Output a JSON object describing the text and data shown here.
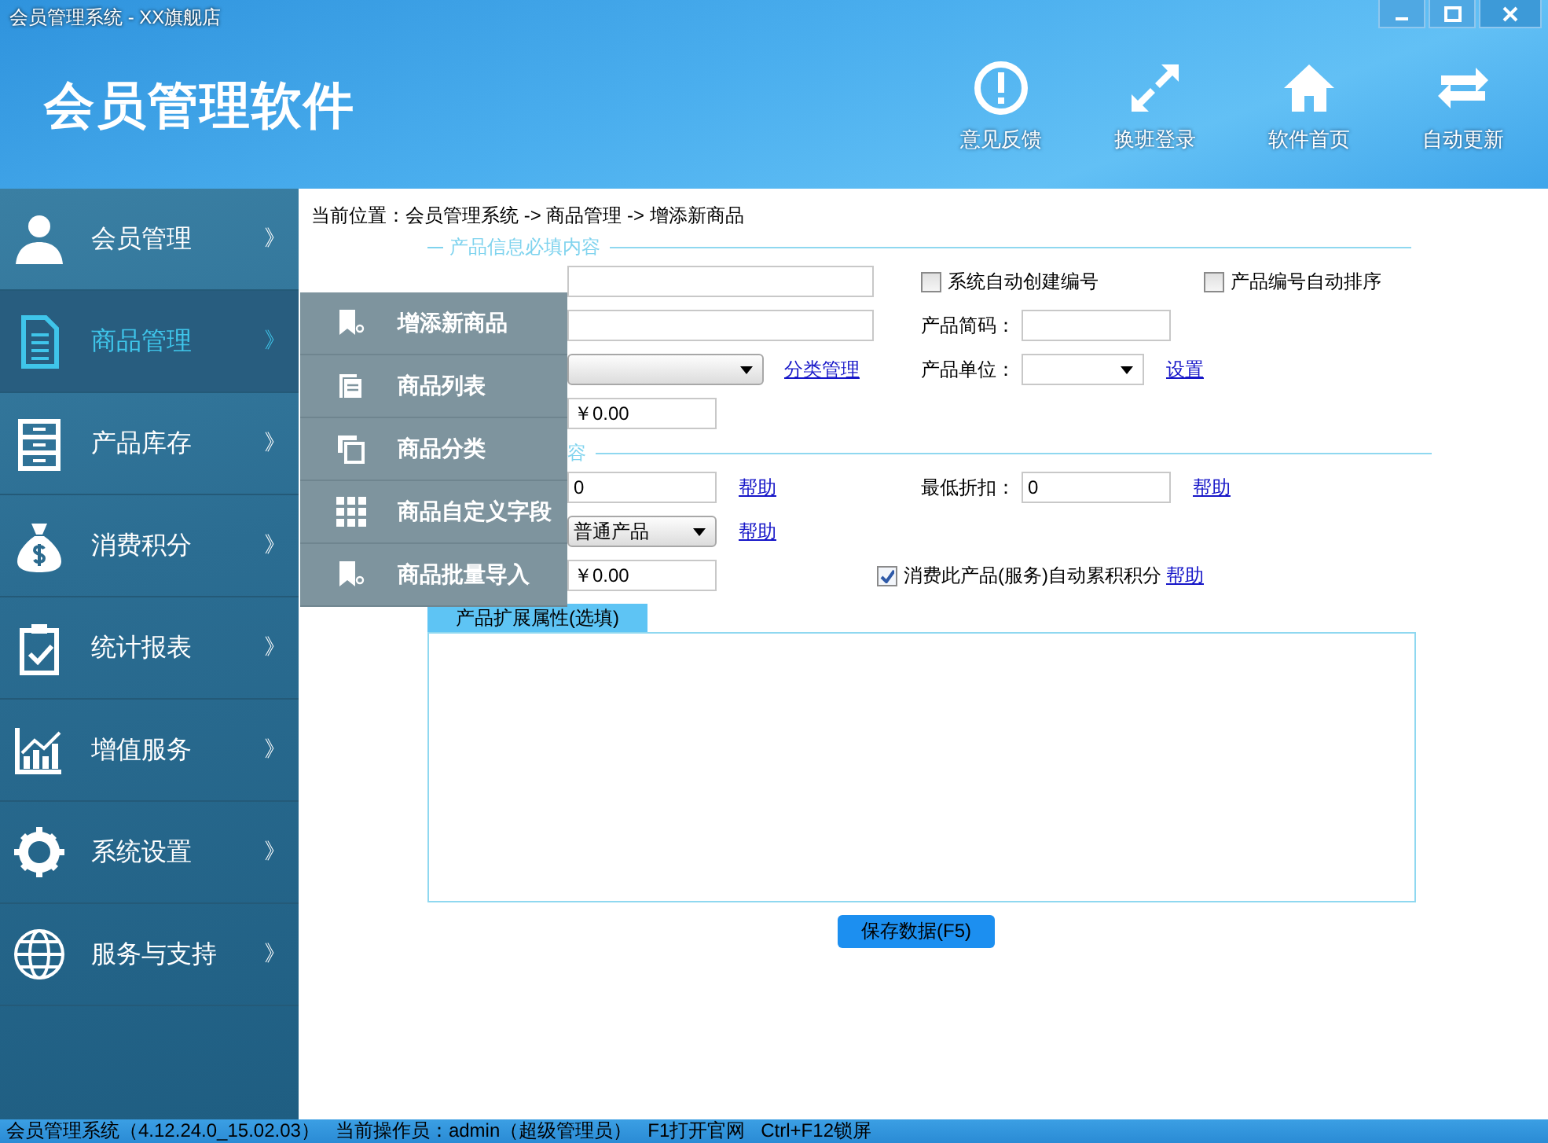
{
  "window": {
    "title": "会员管理系统 - XX旗舰店",
    "controls": [
      {
        "kind": "minimize"
      },
      {
        "kind": "maximize"
      },
      {
        "kind": "close"
      }
    ]
  },
  "app_title": "会员管理软件",
  "toolbar": [
    {
      "label": "意见反馈"
    },
    {
      "label": "换班登录"
    },
    {
      "label": "软件首页"
    },
    {
      "label": "自动更新"
    }
  ],
  "sidebar": {
    "items": [
      {
        "label": "会员管理",
        "arrow": "》",
        "selected": false
      },
      {
        "label": "商品管理",
        "arrow": "》",
        "selected": true
      },
      {
        "label": "产品库存",
        "arrow": "》",
        "selected": false
      },
      {
        "label": "消费积分",
        "arrow": "》",
        "selected": false
      },
      {
        "label": "统计报表",
        "arrow": "》",
        "selected": false
      },
      {
        "label": "增值服务",
        "arrow": "》",
        "selected": false
      },
      {
        "label": "系统设置",
        "arrow": "》",
        "selected": false
      },
      {
        "label": "服务与支持",
        "arrow": "》",
        "selected": false
      }
    ]
  },
  "submenu": [
    {
      "label": "增添新商品"
    },
    {
      "label": "商品列表"
    },
    {
      "label": "商品分类"
    },
    {
      "label": "商品自定义字段"
    },
    {
      "label": "商品批量导入"
    }
  ],
  "breadcrumb": "当前位置：会员管理系统 -> 商品管理 -> 增添新商品",
  "sections": [
    {
      "legend": "产品信息必填内容",
      "rows": [
        [
          [
            {
              "kind": "input"
            }
          ],
          [
            {
              "kind": "checkbox",
              "label": "系统自动创建编号",
              "checked": false
            }
          ],
          [
            {
              "kind": "checkbox",
              "label": "产品编号自动排序",
              "checked": false
            }
          ]
        ],
        [
          [
            {
              "kind": "input"
            }
          ],
          [
            {
              "kind": "label",
              "text": "产品简码："
            },
            {
              "kind": "short-input"
            }
          ],
          []
        ],
        [
          [
            {
              "kind": "select"
            },
            {
              "kind": "link",
              "text": "分类管理"
            }
          ],
          [
            {
              "kind": "label",
              "text": "产品单位："
            },
            {
              "kind": "short-select"
            },
            {
              "kind": "link",
              "text": "设置"
            }
          ],
          []
        ],
        [
          [
            {
              "kind": "short-input",
              "value": "￥0.00"
            }
          ],
          [],
          []
        ]
      ]
    },
    {
      "legend": "容",
      "rows": [
        [
          [
            {
              "kind": "short-input",
              "value": "0"
            },
            {
              "kind": "link",
              "text": "帮助"
            }
          ],
          [
            {
              "kind": "label",
              "text": "最低折扣："
            },
            {
              "kind": "short-input",
              "value": "0"
            },
            {
              "kind": "link",
              "text": "帮助"
            }
          ],
          []
        ],
        [
          [
            {
              "kind": "short-select",
              "value": "普通产品"
            },
            {
              "kind": "link",
              "text": "帮助"
            }
          ],
          [],
          []
        ],
        [
          [
            {
              "kind": "short-input",
              "value": "￥0.00"
            }
          ],
          [
            {
              "kind": "checkbox",
              "label": "消费此产品(服务)自动累积积分",
              "checked": true
            },
            {
              "kind": "link",
              "text": "帮助"
            }
          ],
          []
        ]
      ]
    }
  ],
  "extension_tab": {
    "label": "产品扩展属性(选填)",
    "selected": true
  },
  "save_button": "保存数据(F5)",
  "status_bar": [
    "会员管理系统（4.12.24.0_15.02.03）",
    "当前操作员：admin（超级管理员）",
    "F1打开官网",
    "Ctrl+F12锁屏"
  ]
}
